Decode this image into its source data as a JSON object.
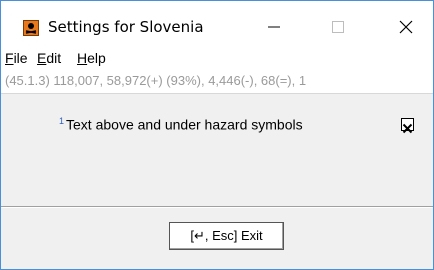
{
  "window": {
    "title": "Settings for Slovenia",
    "icon": "hazard-icon",
    "controls": [
      "minimize",
      "maximize",
      "close"
    ]
  },
  "menu": {
    "file": {
      "label": "File",
      "mnemonic": "F",
      "rest": "ile"
    },
    "edit": {
      "label": "Edit",
      "mnemonic": "E",
      "rest": "dit"
    },
    "help": {
      "label": "Help",
      "mnemonic": "H",
      "rest": "elp"
    }
  },
  "status": {
    "text": "(45.1.3) 118,007, 58,972(+) (93%), 4,446(-), 68(=), 1"
  },
  "option": {
    "footnote": "1",
    "label": "Text above and under hazard symbols",
    "checked": true
  },
  "footer": {
    "exit_label": "[↵, Esc] Exit"
  },
  "colors": {
    "window_border": "#4a90d9",
    "status_text": "#9a9a9a",
    "footnote": "#3060c0",
    "icon": "#e8781c"
  }
}
